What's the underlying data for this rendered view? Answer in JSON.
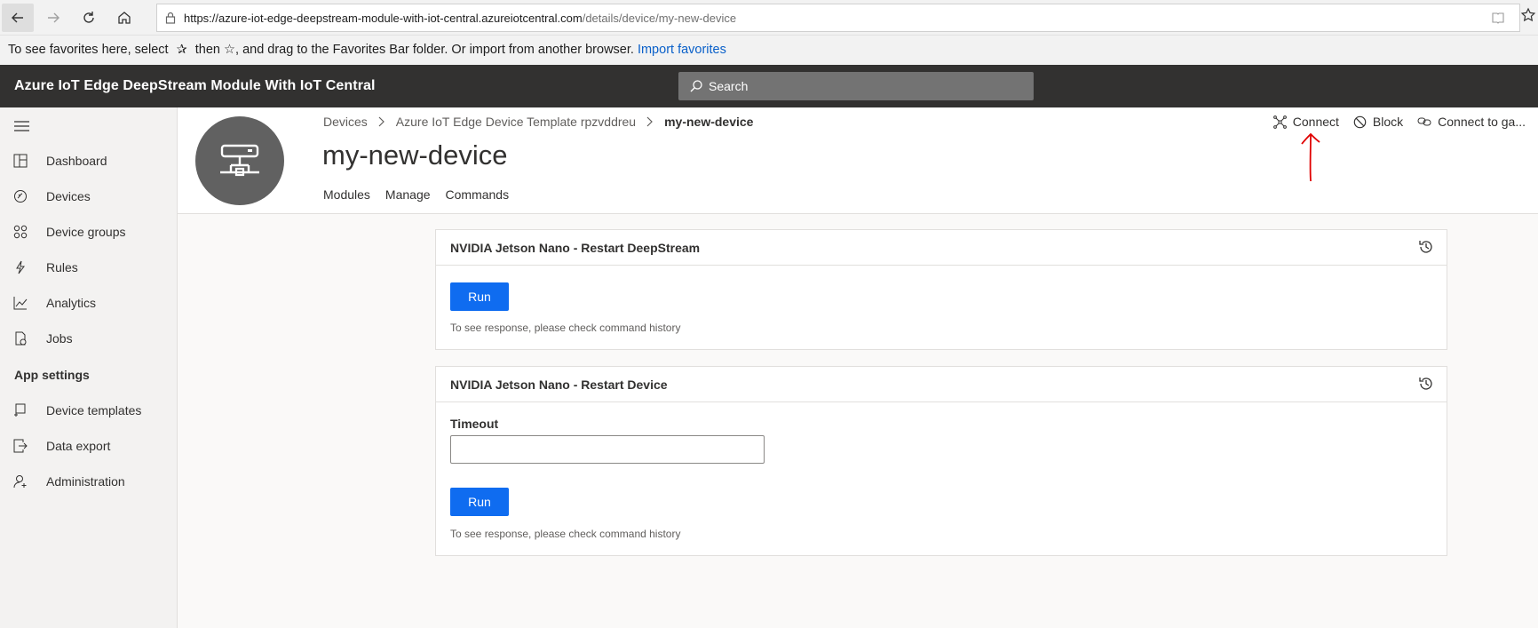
{
  "browser": {
    "url_host": "https://azure-iot-edge-deepstream-module-with-iot-central.azureiotcentral.com",
    "url_path": "/details/device/my-new-device",
    "favorites_text_1": "To see favorites here, select",
    "favorites_text_2": "then ☆, and drag to the Favorites Bar folder. Or import from another browser.",
    "import_link": "Import favorites"
  },
  "app": {
    "title": "Azure IoT Edge DeepStream Module With IoT Central",
    "search_placeholder": "Search"
  },
  "sidebar": {
    "items": [
      {
        "label": "Dashboard",
        "icon": "dashboard-icon"
      },
      {
        "label": "Devices",
        "icon": "devices-icon"
      },
      {
        "label": "Device groups",
        "icon": "device-groups-icon"
      },
      {
        "label": "Rules",
        "icon": "rules-icon"
      },
      {
        "label": "Analytics",
        "icon": "analytics-icon"
      },
      {
        "label": "Jobs",
        "icon": "jobs-icon"
      }
    ],
    "section_label": "App settings",
    "settings_items": [
      {
        "label": "Device templates",
        "icon": "device-templates-icon"
      },
      {
        "label": "Data export",
        "icon": "data-export-icon"
      },
      {
        "label": "Administration",
        "icon": "administration-icon"
      }
    ]
  },
  "device": {
    "breadcrumb": [
      "Devices",
      "Azure IoT Edge Device Template rpzvddreu",
      "my-new-device"
    ],
    "title": "my-new-device",
    "tabs": [
      "Modules",
      "Manage",
      "Commands"
    ],
    "actions": [
      {
        "label": "Connect",
        "icon": "connect-icon"
      },
      {
        "label": "Block",
        "icon": "block-icon"
      },
      {
        "label": "Connect to ga...",
        "icon": "link-icon"
      }
    ]
  },
  "commands": [
    {
      "title": "NVIDIA Jetson Nano - Restart DeepStream",
      "run_label": "Run",
      "hint": "To see response, please check command history"
    },
    {
      "title": "NVIDIA Jetson Nano - Restart Device",
      "field_label": "Timeout",
      "field_value": "",
      "run_label": "Run",
      "hint": "To see response, please check command history"
    }
  ],
  "colors": {
    "header_bg": "#323130",
    "primary_button": "#0f6cf0",
    "link": "#0a60c9",
    "annotation": "#e00000"
  }
}
